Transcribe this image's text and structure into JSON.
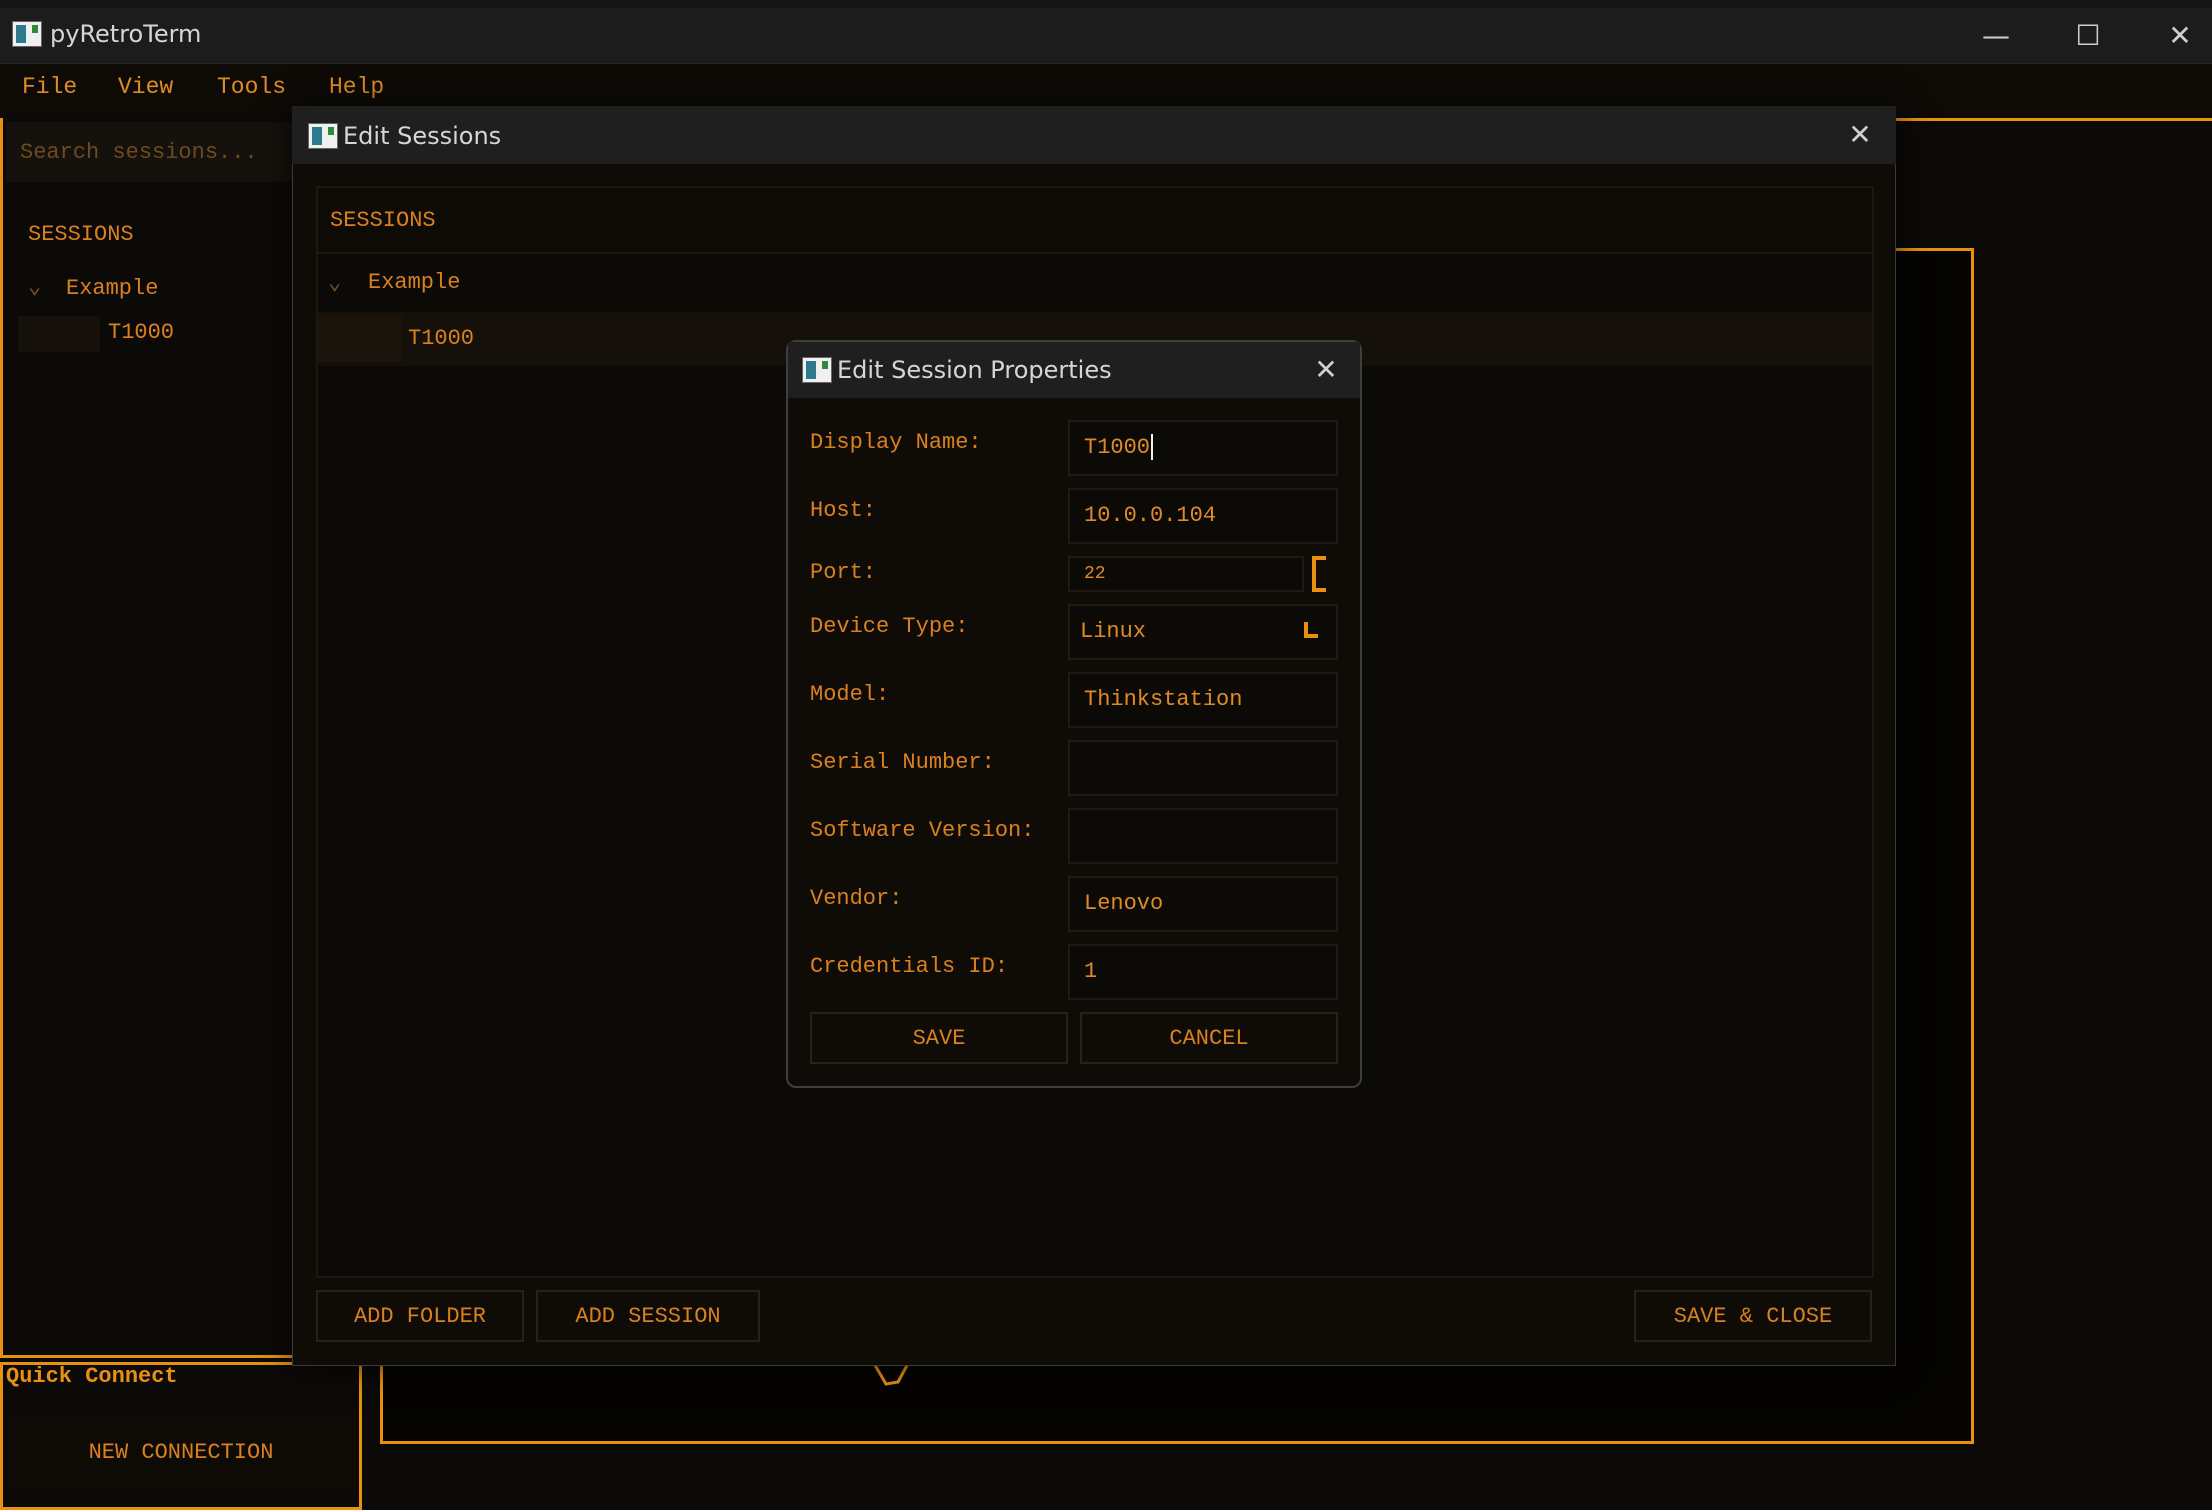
{
  "window": {
    "title": "pyRetroTerm",
    "controls": [
      "—",
      "☐",
      "✕"
    ]
  },
  "menubar": {
    "items": [
      "File",
      "View",
      "Tools",
      "Help"
    ]
  },
  "sidebar": {
    "search_placeholder": "Search sessions...",
    "header": "SESSIONS",
    "folder": "Example",
    "session": "T1000"
  },
  "quick_connect": {
    "title": "Quick Connect",
    "button": "NEW CONNECTION"
  },
  "edit_sessions": {
    "title": "Edit Sessions",
    "header": "SESSIONS",
    "folder": "Example",
    "session": "T1000",
    "buttons": {
      "add_folder": "ADD FOLDER",
      "add_session": "ADD SESSION",
      "save_close": "SAVE & CLOSE"
    }
  },
  "session_properties": {
    "title": "Edit Session Properties",
    "fields": {
      "display_name": {
        "label": "Display Name:",
        "value": "T1000"
      },
      "host": {
        "label": "Host:",
        "value": "10.0.0.104"
      },
      "port": {
        "label": "Port:",
        "value": "22"
      },
      "device_type": {
        "label": "Device Type:",
        "value": "Linux"
      },
      "model": {
        "label": "Model:",
        "value": "Thinkstation"
      },
      "serial_number": {
        "label": "Serial Number:",
        "value": ""
      },
      "software_version": {
        "label": "Software Version:",
        "value": ""
      },
      "vendor": {
        "label": "Vendor:",
        "value": "Lenovo"
      },
      "credentials_id": {
        "label": "Credentials ID:",
        "value": "1"
      }
    },
    "buttons": {
      "save": "SAVE",
      "cancel": "CANCEL"
    }
  },
  "colors": {
    "accent": "#e8900f",
    "text": "#d9801f",
    "background": "#0c0a08"
  }
}
